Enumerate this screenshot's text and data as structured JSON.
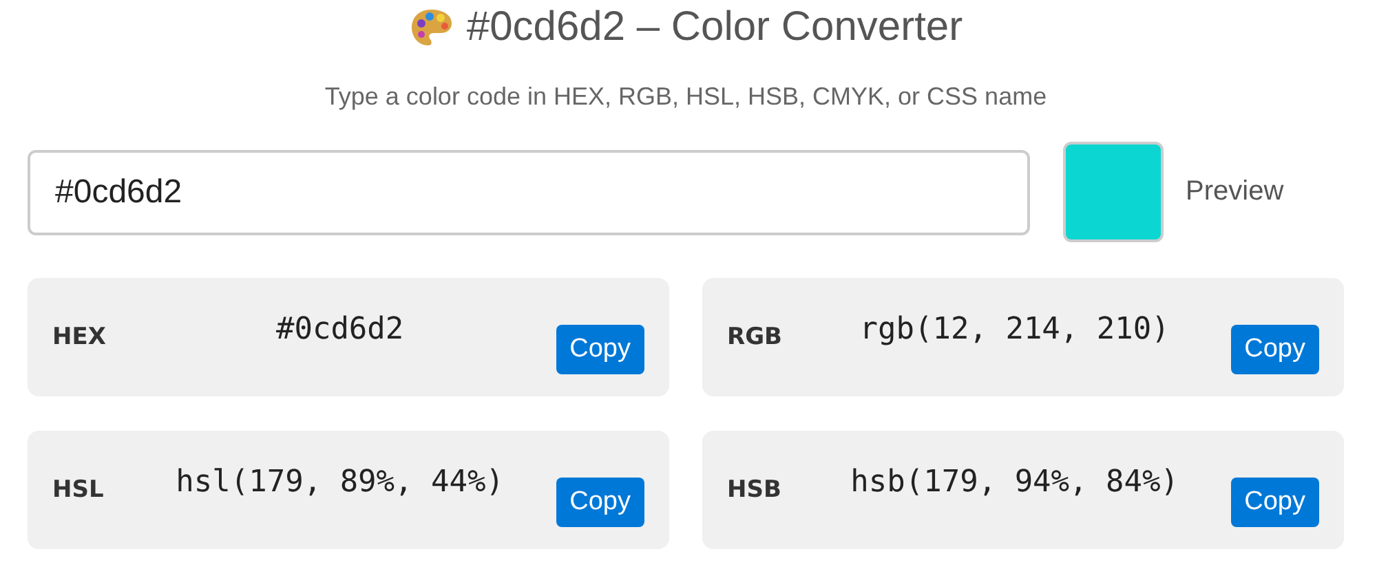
{
  "title": "#0cd6d2 – Color Converter",
  "subtitle": "Type a color code in HEX, RGB, HSL, HSB, CMYK, or CSS name",
  "input": {
    "value": "#0cd6d2"
  },
  "preview": {
    "color": "#0cd6d2",
    "label": "Preview"
  },
  "formats": [
    {
      "label": "HEX",
      "value": "#0cd6d2",
      "button": "Copy"
    },
    {
      "label": "RGB",
      "value": "rgb(12, 214, 210)",
      "button": "Copy"
    },
    {
      "label": "HSL",
      "value": "hsl(179, 89%, 44%)",
      "button": "Copy"
    },
    {
      "label": "HSB",
      "value": "hsb(179, 94%, 84%)",
      "button": "Copy"
    }
  ]
}
